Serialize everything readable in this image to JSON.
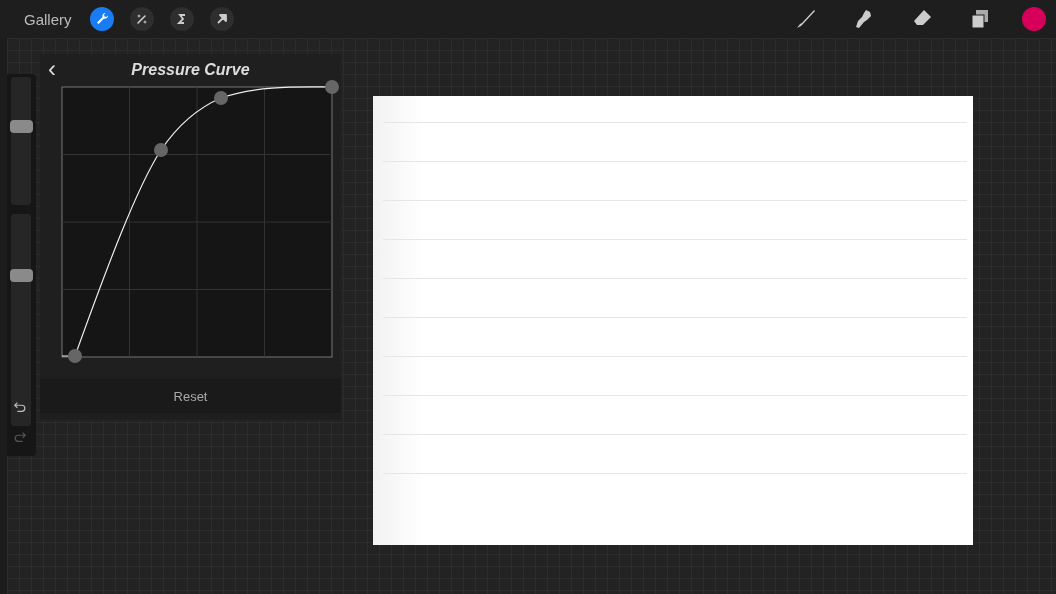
{
  "top_bar": {
    "gallery": "Gallery",
    "left_tools": [
      {
        "selected": true
      },
      {
        "selected": false
      },
      {
        "selected": false
      },
      {
        "selected": false
      }
    ]
  },
  "sidebar": {
    "sliders": [
      {
        "level": 0.62
      },
      {
        "level": 0.71
      }
    ]
  },
  "panel": {
    "back": "‹",
    "title": "Pressure Curve",
    "reset": "Reset"
  }
}
